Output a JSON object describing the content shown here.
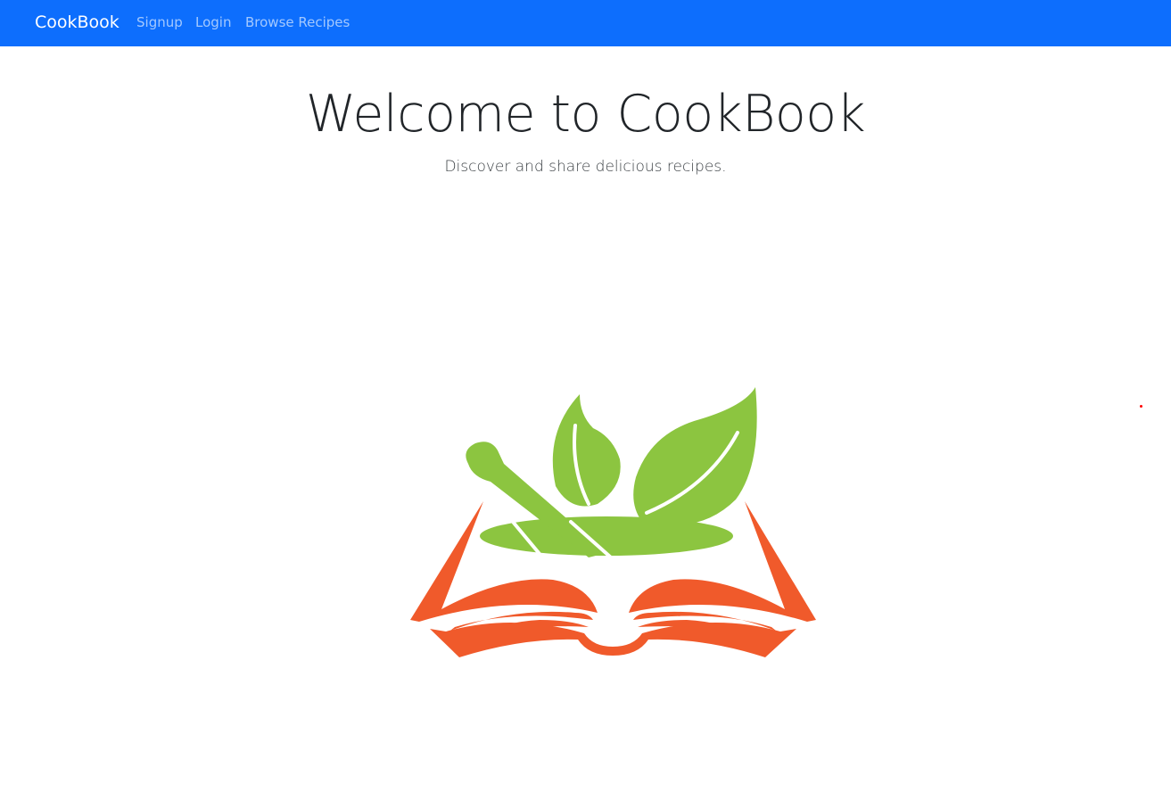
{
  "navbar": {
    "brand": "CookBook",
    "links": [
      {
        "label": "Signup"
      },
      {
        "label": "Login"
      },
      {
        "label": "Browse Recipes"
      }
    ],
    "background_color": "#0d6efd"
  },
  "hero": {
    "title": "Welcome to CookBook",
    "subtitle": "Discover and share delicious recipes."
  },
  "logo": {
    "icon": "mortar-pestle-book-logo",
    "colors": {
      "leaf": "#8cc540",
      "book": "#f05a2b"
    }
  }
}
